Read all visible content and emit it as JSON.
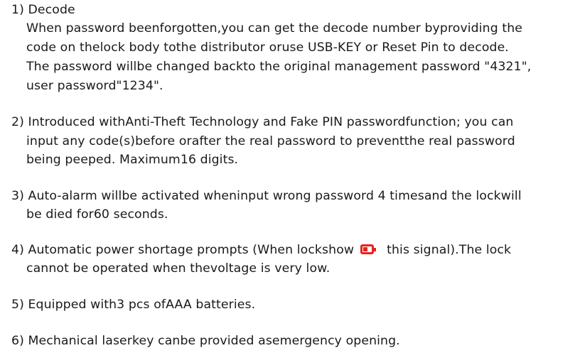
{
  "items": [
    {
      "heading": "1) Decode",
      "lines": [
        "When password beenforgotten,you can get the decode number byproviding the",
        "code on thelock body tothe distributor oruse USB-KEY or Reset Pin to decode.",
        "The password willbe changed backto the original management password \"4321\",",
        "user password\"1234\"."
      ]
    },
    {
      "lines": [
        "2) Introduced withAnti-Theft Technology and Fake PIN passwordfunction; you can",
        "input any code(s)before orafter the real password to preventthe real password",
        "being peeped. Maximum16 digits."
      ]
    },
    {
      "lines": [
        "3) Auto-alarm willbe activated wheninput wrong password 4 timesand the lockwill",
        "be died for60 seconds."
      ]
    },
    {
      "line1_before": "4) Automatic power shortage prompts (When lockshow",
      "line1_after": "this signal).The lock",
      "icon": "battery-low-icon",
      "icon_color": "#e8231f",
      "lines": [
        "cannot be operated when thevoltage is very low."
      ]
    },
    {
      "lines": [
        "5) Equipped with3 pcs ofAAA batteries."
      ]
    },
    {
      "lines": [
        "6) Mechanical laserkey canbe provided asemergency opening."
      ]
    }
  ]
}
